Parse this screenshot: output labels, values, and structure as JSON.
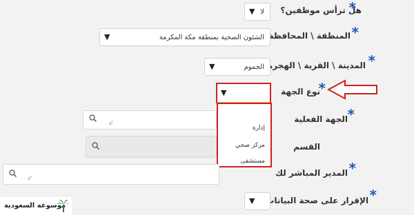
{
  "rows": {
    "employee_head": {
      "label": "هل ترأس موظفين؟",
      "value": "لا"
    },
    "region": {
      "label": "المنطقة \\ المحافظة",
      "value": "الشئون الصحية بمنطقة مكة المكرمة"
    },
    "city": {
      "label": "المدينة \\ القرية \\ الهجرة",
      "value": "الجموم"
    },
    "entity_type": {
      "label": "نوع الجهة",
      "options": [
        "إدارة",
        "مركز صحي",
        "مستشفى"
      ]
    },
    "actual_entity": {
      "label": "الجهة الفعلية"
    },
    "department": {
      "label": "القسم"
    },
    "manager": {
      "label": "المدير المباشر لك"
    },
    "declaration": {
      "label": "الإقرار على صحة البيانات"
    }
  },
  "icons": {
    "required": "asterisk-icon",
    "search": "search-icon",
    "dropdown": "triangle-down-icon",
    "pointer": "arrow-left-icon"
  },
  "colors": {
    "required_star": "#1f57b5",
    "highlight": "#cc1f1f",
    "focus_underline": "#e2b04b",
    "logo_green": "#2e7d32"
  },
  "logo": {
    "text": "موسوعة السعودية"
  }
}
